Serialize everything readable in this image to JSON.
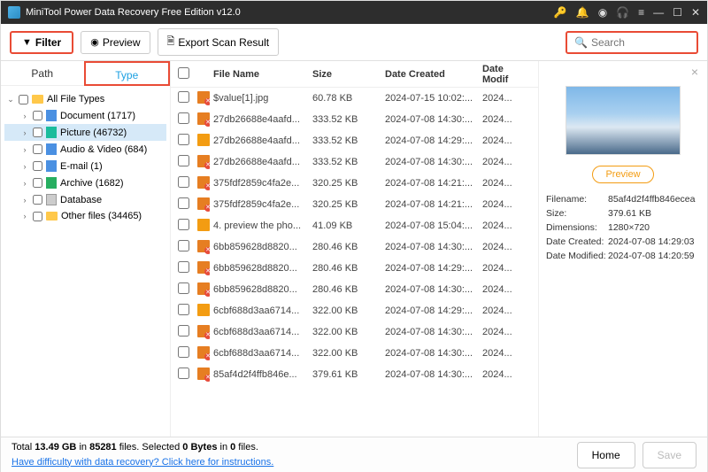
{
  "window": {
    "title": "MiniTool Power Data Recovery Free Edition v12.0"
  },
  "toolbar": {
    "filter": "Filter",
    "preview": "Preview",
    "export": "Export Scan Result",
    "search_placeholder": "Search"
  },
  "sidebar": {
    "tabs": {
      "path": "Path",
      "type": "Type"
    },
    "root": "All File Types",
    "items": [
      {
        "label": "Document (1717)",
        "iconClass": "blue"
      },
      {
        "label": "Picture (46732)",
        "iconClass": "teal",
        "selected": true
      },
      {
        "label": "Audio & Video (684)",
        "iconClass": "blue"
      },
      {
        "label": "E-mail (1)",
        "iconClass": "blue"
      },
      {
        "label": "Archive (1682)",
        "iconClass": "green"
      },
      {
        "label": "Database",
        "iconClass": "gray"
      },
      {
        "label": "Other files (34465)",
        "iconClass": "folder"
      }
    ]
  },
  "table": {
    "headers": {
      "name": "File Name",
      "size": "Size",
      "created": "Date Created",
      "modified": "Date Modif"
    },
    "rows": [
      {
        "name": "$value[1].jpg",
        "size": "60.78 KB",
        "created": "2024-07-15 10:02:...",
        "modified": "2024...",
        "del": true
      },
      {
        "name": "27db26688e4aafd...",
        "size": "333.52 KB",
        "created": "2024-07-08 14:30:...",
        "modified": "2024...",
        "del": true
      },
      {
        "name": "27db26688e4aafd...",
        "size": "333.52 KB",
        "created": "2024-07-08 14:29:...",
        "modified": "2024...",
        "del": false
      },
      {
        "name": "27db26688e4aafd...",
        "size": "333.52 KB",
        "created": "2024-07-08 14:30:...",
        "modified": "2024...",
        "del": true
      },
      {
        "name": "375fdf2859c4fa2e...",
        "size": "320.25 KB",
        "created": "2024-07-08 14:21:...",
        "modified": "2024...",
        "del": true
      },
      {
        "name": "375fdf2859c4fa2e...",
        "size": "320.25 KB",
        "created": "2024-07-08 14:21:...",
        "modified": "2024...",
        "del": true
      },
      {
        "name": "4. preview the pho...",
        "size": "41.09 KB",
        "created": "2024-07-08 15:04:...",
        "modified": "2024...",
        "del": false
      },
      {
        "name": "6bb859628d8820...",
        "size": "280.46 KB",
        "created": "2024-07-08 14:30:...",
        "modified": "2024...",
        "del": true
      },
      {
        "name": "6bb859628d8820...",
        "size": "280.46 KB",
        "created": "2024-07-08 14:29:...",
        "modified": "2024...",
        "del": true
      },
      {
        "name": "6bb859628d8820...",
        "size": "280.46 KB",
        "created": "2024-07-08 14:30:...",
        "modified": "2024...",
        "del": true
      },
      {
        "name": "6cbf688d3aa6714...",
        "size": "322.00 KB",
        "created": "2024-07-08 14:29:...",
        "modified": "2024...",
        "del": false
      },
      {
        "name": "6cbf688d3aa6714...",
        "size": "322.00 KB",
        "created": "2024-07-08 14:30:...",
        "modified": "2024...",
        "del": true
      },
      {
        "name": "6cbf688d3aa6714...",
        "size": "322.00 KB",
        "created": "2024-07-08 14:30:...",
        "modified": "2024...",
        "del": true
      },
      {
        "name": "85af4d2f4ffb846e...",
        "size": "379.61 KB",
        "created": "2024-07-08 14:30:...",
        "modified": "2024...",
        "del": true
      }
    ]
  },
  "preview": {
    "button": "Preview",
    "meta": {
      "filename_k": "Filename:",
      "filename_v": "85af4d2f4ffb846ecea",
      "size_k": "Size:",
      "size_v": "379.61 KB",
      "dim_k": "Dimensions:",
      "dim_v": "1280×720",
      "created_k": "Date Created:",
      "created_v": "2024-07-08 14:29:03",
      "modified_k": "Date Modified:",
      "modified_v": "2024-07-08 14:20:59"
    }
  },
  "footer": {
    "total_prefix": "Total ",
    "total_size": "13.49 GB",
    "in1": " in ",
    "total_files": "85281",
    "files_suffix": " files.",
    "selected_prefix": "  Selected ",
    "sel_bytes": "0 Bytes",
    "in2": " in ",
    "sel_files": "0",
    "sel_suffix": " files.",
    "help_link": "Have difficulty with data recovery? Click here for instructions.",
    "home": "Home",
    "save": "Save"
  }
}
